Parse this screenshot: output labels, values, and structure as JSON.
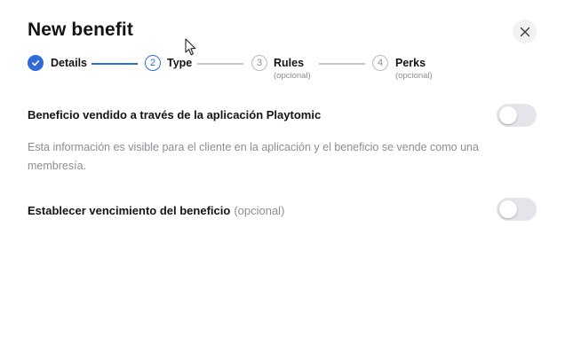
{
  "modal": {
    "title": "New benefit",
    "close_icon": "close-icon"
  },
  "stepper": {
    "steps": [
      {
        "number": "",
        "label": "Details",
        "sub": "",
        "state": "done",
        "icon": "check-icon"
      },
      {
        "number": "2",
        "label": "Type",
        "sub": "",
        "state": "active"
      },
      {
        "number": "3",
        "label": "Rules",
        "sub": "(opcional)",
        "state": "todo"
      },
      {
        "number": "4",
        "label": "Perks",
        "sub": "(opcional)",
        "state": "todo"
      }
    ]
  },
  "form": {
    "sold_via_app": {
      "label": "Beneficio vendido a través de la aplicación Playtomic",
      "enabled": false,
      "help": "Esta información es visible para el cliente en la aplicación y el beneficio se vende como una membresía."
    },
    "expiration": {
      "label": "Establecer vencimiento del beneficio",
      "optional": "(opcional)",
      "enabled": false
    }
  },
  "colors": {
    "accent": "#2e6bd7",
    "text": "#141416",
    "muted": "#8b8d94",
    "toggle_off": "#e4e5e8"
  }
}
